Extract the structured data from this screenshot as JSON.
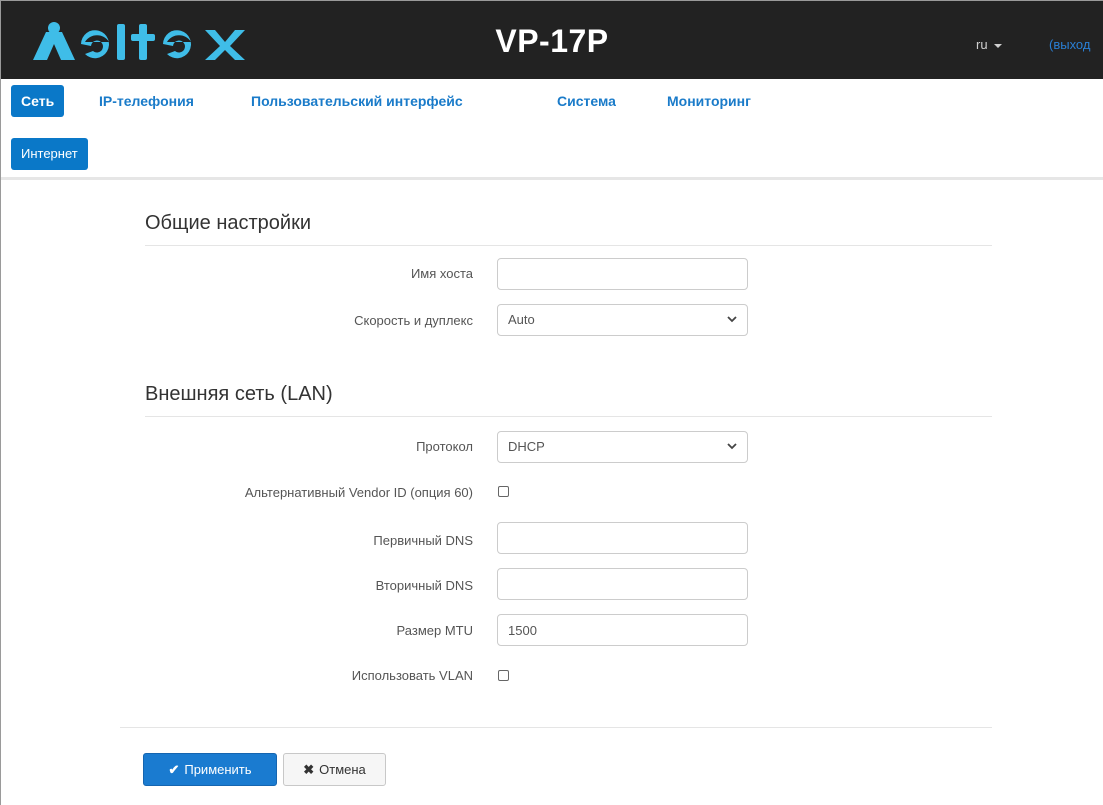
{
  "header": {
    "title": "VP-17P",
    "language": "ru",
    "logout_label": "(выход"
  },
  "nav": {
    "tabs": [
      {
        "label": "Сеть",
        "active": true
      },
      {
        "label": "IP-телефония",
        "active": false
      },
      {
        "label": "Пользовательский интерфейс",
        "active": false
      },
      {
        "label": "Система",
        "active": false
      },
      {
        "label": "Мониторинг",
        "active": false
      }
    ],
    "subtabs": [
      {
        "label": "Интернет",
        "active": true
      }
    ]
  },
  "general": {
    "title": "Общие настройки",
    "hostname_label": "Имя хоста",
    "hostname_value": "",
    "speed_label": "Скорость и дуплекс",
    "speed_value": "Auto"
  },
  "lan": {
    "title": "Внешняя сеть (LAN)",
    "protocol_label": "Протокол",
    "protocol_value": "DHCP",
    "vendor_id_label": "Альтернативный Vendor ID (опция 60)",
    "vendor_id_checked": false,
    "dns1_label": "Первичный DNS",
    "dns1_value": "",
    "dns2_label": "Вторичный DNS",
    "dns2_value": "",
    "mtu_label": "Размер MTU",
    "mtu_value": "1500",
    "vlan_label": "Использовать VLAN",
    "vlan_checked": false
  },
  "actions": {
    "apply_label": "Применить",
    "cancel_label": "Отмена"
  },
  "colors": {
    "topbar": "#222222",
    "brand_blue": "#0a78c8",
    "link_blue": "#1a7bc9"
  },
  "icons": {
    "logo": "eltex-logo",
    "apply": "check-icon",
    "cancel": "close-icon"
  }
}
